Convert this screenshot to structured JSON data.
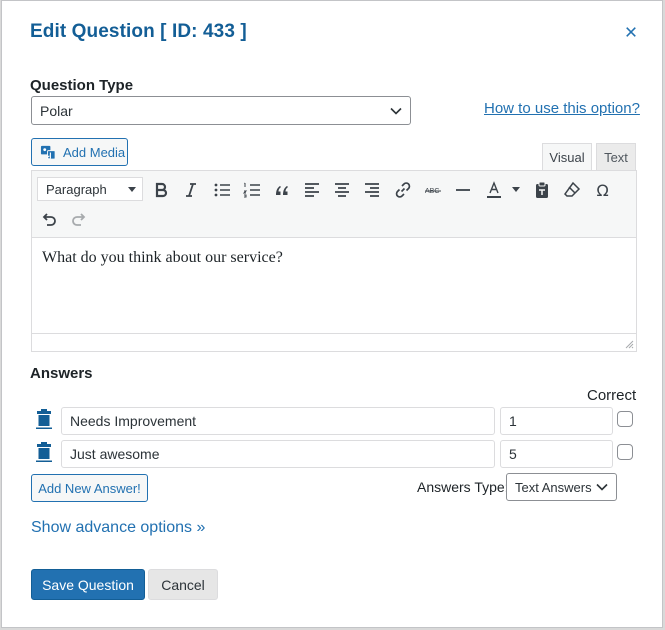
{
  "modal": {
    "title": "Edit Question [ ID: 433 ]",
    "close_icon": "close-icon"
  },
  "question_type": {
    "label": "Question Type",
    "selected": "Polar",
    "help_link": "How to use this option?"
  },
  "editor": {
    "add_media_label": "Add Media",
    "tabs": {
      "visual": "Visual",
      "text": "Text"
    },
    "format_select": "Paragraph",
    "toolbar_icons": [
      "bold-icon",
      "italic-icon",
      "bullet-list-icon",
      "numbered-list-icon",
      "blockquote-icon",
      "align-left-icon",
      "align-center-icon",
      "align-right-icon",
      "link-icon",
      "strikethrough-icon",
      "horizontal-line-icon",
      "text-color-icon",
      "paste-text-icon",
      "clear-formatting-icon",
      "special-character-icon",
      "undo-icon",
      "redo-icon"
    ],
    "content": "What do you think about our service?"
  },
  "answers": {
    "heading": "Answers",
    "correct_label": "Correct",
    "rows": [
      {
        "text": "Needs Improvement",
        "value": "1",
        "correct": false
      },
      {
        "text": "Just awesome",
        "value": "5",
        "correct": false
      }
    ],
    "add_button": "Add New Answer!",
    "type_label": "Answers Type:",
    "type_selected": "Text Answers"
  },
  "advanced_link": "Show advance options »",
  "footer": {
    "save_label": "Save Question",
    "cancel_label": "Cancel"
  },
  "colors": {
    "accent": "#2271b1",
    "title": "#135e96"
  }
}
